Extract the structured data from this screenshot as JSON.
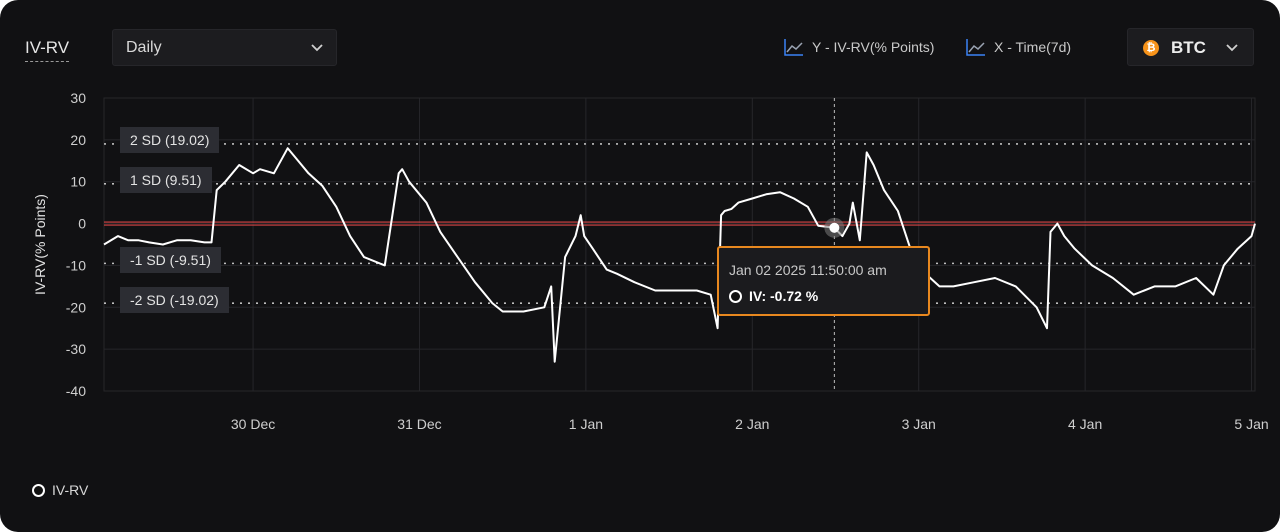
{
  "header": {
    "title": "IV-RV",
    "period_select": "Daily",
    "y_legend": "Y - IV-RV(% Points)",
    "x_legend": "X - Time(7d)",
    "coin": "BTC"
  },
  "tooltip": {
    "date": "Jan 02 2025 11:50:00 am",
    "value": "IV: -0.72 %"
  },
  "sd_labels": [
    "2 SD (19.02)",
    "1 SD (9.51)",
    "-1 SD (-9.51)",
    "-2 SD (-19.02)"
  ],
  "colors": {
    "background": "#111113",
    "line": "#ffffff",
    "zero_line": "#d64545",
    "tooltip_border": "#e8881f",
    "legend_icon": "#3b82f6"
  },
  "chart_data": {
    "type": "line",
    "title": "",
    "xlabel": "",
    "ylabel": "IV-RV(% Points)",
    "ylim": [
      -40,
      30
    ],
    "yticks": [
      30,
      20,
      10,
      0,
      -10,
      -20,
      -30,
      -40
    ],
    "xticks": [
      "30 Dec",
      "31 Dec",
      "1 Jan",
      "2 Jan",
      "3 Jan",
      "4 Jan",
      "5 Jan"
    ],
    "xlim": [
      "2024-12-29T02:30",
      "2025-01-05T00:30"
    ],
    "grid": true,
    "sd_lines": [
      19.02,
      9.51,
      -9.51,
      -19.02
    ],
    "highlight_x": "2025-01-02T11:50",
    "series": [
      {
        "name": "IV-RV",
        "x": [
          "2024-12-29T02:30",
          "2024-12-29T04:30",
          "2024-12-29T06:00",
          "2024-12-29T07:30",
          "2024-12-29T09:00",
          "2024-12-29T11:00",
          "2024-12-29T13:00",
          "2024-12-29T15:00",
          "2024-12-29T17:00",
          "2024-12-29T18:00",
          "2024-12-29T18:45",
          "2024-12-29T20:00",
          "2024-12-29T22:00",
          "2024-12-30T00:00",
          "2024-12-30T01:00",
          "2024-12-30T03:00",
          "2024-12-30T05:00",
          "2024-12-30T06:30",
          "2024-12-30T08:00",
          "2024-12-30T10:00",
          "2024-12-30T12:00",
          "2024-12-30T14:00",
          "2024-12-30T16:00",
          "2024-12-30T19:00",
          "2024-12-30T21:00",
          "2024-12-30T21:30",
          "2024-12-30T22:30",
          "2024-12-31T01:00",
          "2024-12-31T03:00",
          "2024-12-31T05:30",
          "2024-12-31T08:00",
          "2024-12-31T10:30",
          "2024-12-31T12:00",
          "2024-12-31T15:00",
          "2024-12-31T18:00",
          "2024-12-31T19:00",
          "2024-12-31T19:30",
          "2024-12-31T21:00",
          "2024-12-31T22:30",
          "2024-12-31T23:15",
          "2024-12-31T23:45",
          "2025-01-01T01:00",
          "2025-01-01T03:00",
          "2025-01-01T04:30",
          "2025-01-01T07:00",
          "2025-01-01T10:00",
          "2025-01-01T13:00",
          "2025-01-01T16:00",
          "2025-01-01T18:00",
          "2025-01-01T19:00",
          "2025-01-01T19:30",
          "2025-01-01T20:00",
          "2025-01-01T21:00",
          "2025-01-01T22:00",
          "2025-01-02T00:00",
          "2025-01-02T02:00",
          "2025-01-02T04:00",
          "2025-01-02T06:00",
          "2025-01-02T08:00",
          "2025-01-02T09:30",
          "2025-01-02T10:30",
          "2025-01-02T11:50",
          "2025-01-02T13:00",
          "2025-01-02T14:00",
          "2025-01-02T14:30",
          "2025-01-02T15:30",
          "2025-01-02T16:30",
          "2025-01-02T17:30",
          "2025-01-02T19:00",
          "2025-01-02T21:00",
          "2025-01-02T23:00",
          "2025-01-03T01:00",
          "2025-01-03T03:00",
          "2025-01-03T05:00",
          "2025-01-03T08:00",
          "2025-01-03T11:00",
          "2025-01-03T14:00",
          "2025-01-03T17:00",
          "2025-01-03T18:30",
          "2025-01-03T19:00",
          "2025-01-03T20:00",
          "2025-01-03T21:00",
          "2025-01-03T22:30",
          "2025-01-04T01:00",
          "2025-01-04T04:00",
          "2025-01-04T07:00",
          "2025-01-04T10:00",
          "2025-01-04T13:00",
          "2025-01-04T16:00",
          "2025-01-04T18:30",
          "2025-01-04T20:00",
          "2025-01-04T22:00",
          "2025-01-05T00:00",
          "2025-01-05T00:30"
        ],
        "y": [
          -5,
          -3,
          -4,
          -4,
          -4.5,
          -5,
          -4,
          -4,
          -4.5,
          -4.5,
          8,
          10,
          14,
          12,
          13,
          12,
          18,
          15,
          12,
          9,
          4,
          -3,
          -8,
          -10,
          12,
          13,
          10,
          5,
          -2,
          -8,
          -14,
          -19,
          -21,
          -21,
          -20,
          -15,
          -33,
          -8,
          -3,
          2,
          -3,
          -6,
          -11,
          -12,
          -14,
          -16,
          -16,
          -16,
          -17,
          -25,
          2,
          3,
          3.5,
          5,
          6,
          7,
          7.5,
          6,
          4,
          -0.5,
          -0.72,
          -1,
          -3,
          0,
          5,
          -4,
          17,
          14,
          8,
          3,
          -7,
          -12,
          -15,
          -15,
          -14,
          -13,
          -15,
          -20,
          -25,
          -2,
          0,
          -3,
          -6,
          -10,
          -13,
          -17,
          -15,
          -15,
          -13,
          -17,
          -10,
          -6,
          -3,
          0
        ]
      }
    ]
  }
}
